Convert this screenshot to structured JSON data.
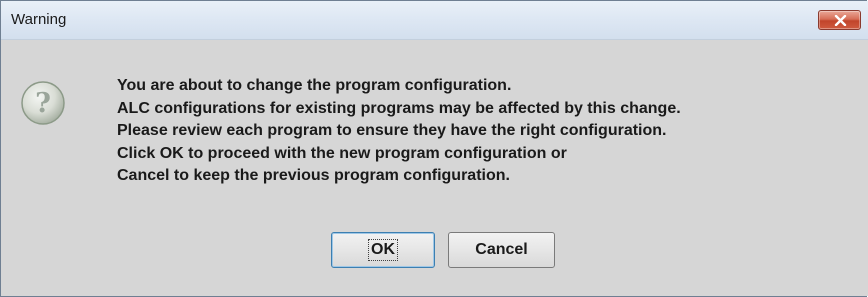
{
  "window": {
    "title": "Warning",
    "close_icon": "close-icon"
  },
  "message": {
    "icon": "question-icon",
    "lines": [
      "You are about to change the program configuration.",
      "ALC configurations for existing programs may be affected by this change.",
      "Please review each program to ensure they have the right configuration.",
      "Click OK to proceed with the new program configuration or",
      "Cancel to keep the previous program configuration."
    ]
  },
  "buttons": {
    "ok_label": "OK",
    "cancel_label": "Cancel"
  },
  "colors": {
    "dialog_background": "#d6d6d6",
    "close_button": "#c1452b",
    "default_button_border": "#3c7fb1"
  }
}
